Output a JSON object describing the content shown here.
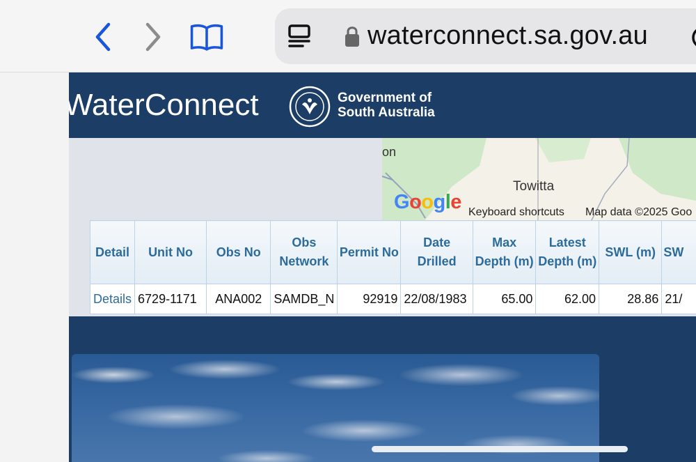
{
  "browser": {
    "url": "waterconnect.sa.gov.au"
  },
  "site": {
    "brand": "WaterConnect",
    "gov_line1": "Government of",
    "gov_line2": "South Australia"
  },
  "map": {
    "label_fragment": "on",
    "town": "Towitta",
    "google_logo": "Google",
    "keyboard_shortcuts": "Keyboard shortcuts",
    "map_data": "Map data ©2025 Goo"
  },
  "table": {
    "headers": [
      "Detail",
      "Unit No",
      "Obs No",
      "Obs Network",
      "Permit No",
      "Date Drilled",
      "Max Depth (m)",
      "Latest Depth (m)",
      "SWL (m)",
      "SW"
    ],
    "rows": [
      [
        "Details",
        "6729-1171",
        "ANA002",
        "SAMDB_N",
        "92919",
        "22/08/1983",
        "65.00",
        "62.00",
        "28.86",
        "21/"
      ]
    ]
  },
  "colors": {
    "header_bg": "#1c3e66",
    "link": "#2d6b9a",
    "browser_accent": "#1a56db"
  },
  "icons": [
    "back-icon",
    "forward-icon",
    "bookmarks-icon",
    "reader-icon",
    "lock-icon",
    "more-icon"
  ]
}
